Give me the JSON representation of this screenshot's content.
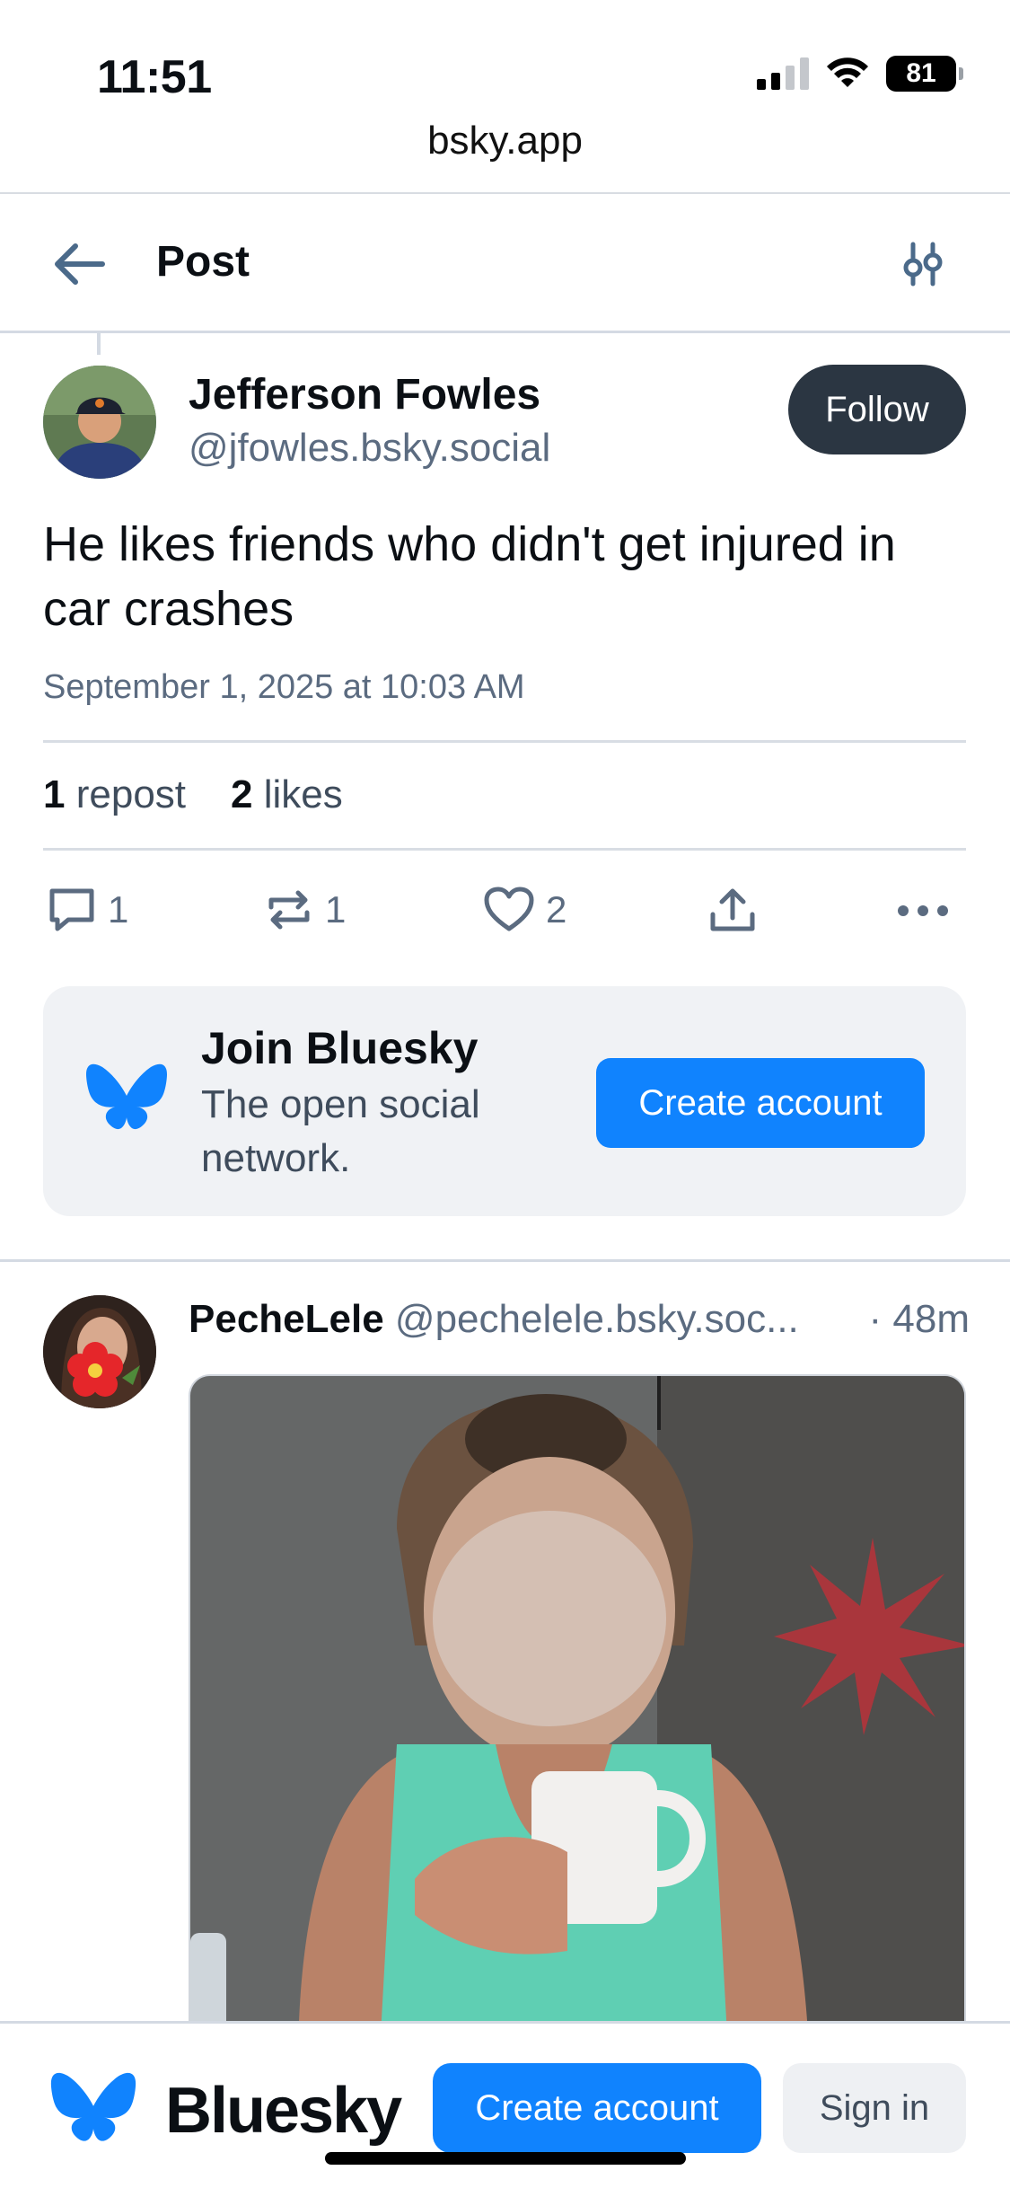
{
  "status_bar": {
    "time": "11:51",
    "battery": "81"
  },
  "browser": {
    "url": "bsky.app"
  },
  "header": {
    "title": "Post"
  },
  "post": {
    "author_name": "Jefferson Fowles",
    "author_handle": "@jfowles.bsky.social",
    "follow_label": "Follow",
    "text": "He likes friends who didn't get injured in car crashes",
    "timestamp": "September 1, 2025 at 10:03 AM",
    "repost_count": "1",
    "repost_label": "repost",
    "like_count": "2",
    "like_label": "likes",
    "actions": {
      "reply_count": "1",
      "repost_count": "1",
      "like_count": "2"
    }
  },
  "join_card": {
    "title": "Join Bluesky",
    "subtitle": "The open social network.",
    "button_label": "Create account"
  },
  "reply": {
    "author_name": "PecheLele",
    "author_handle": "@pechelele.bsky.soc...",
    "time": "· 48m"
  },
  "bottom_bar": {
    "brand": "Bluesky",
    "create_label": "Create account",
    "signin_label": "Sign in"
  },
  "colors": {
    "accent": "#1083fe",
    "follow_button": "#2b3642",
    "muted_text": "#5b6b80",
    "card_bg": "#f0f2f5"
  }
}
